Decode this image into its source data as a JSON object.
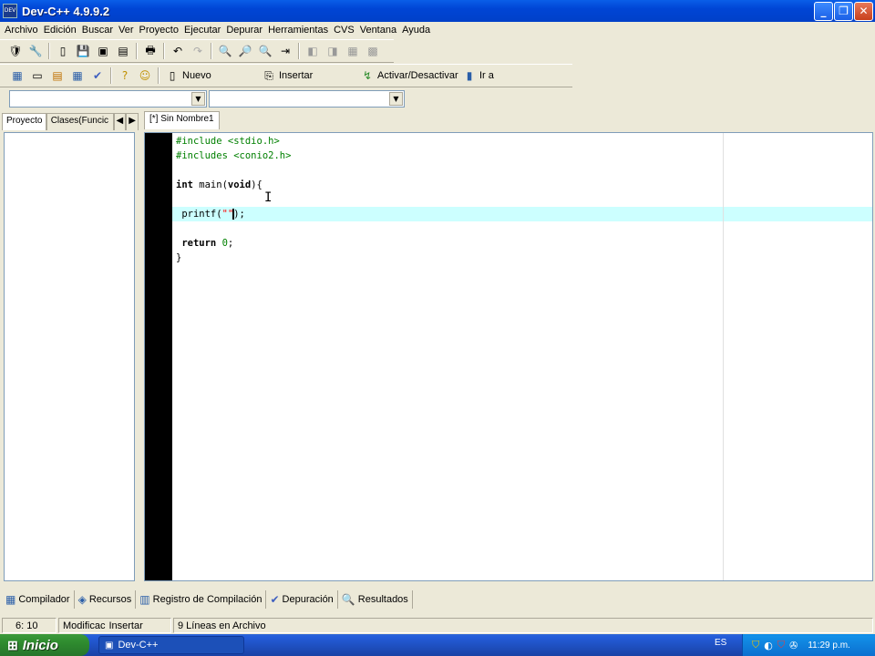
{
  "window": {
    "title": "Dev-C++ 4.9.9.2",
    "icon_label": "DEV"
  },
  "menu": [
    "Archivo",
    "Edición",
    "Buscar",
    "Ver",
    "Proyecto",
    "Ejecutar",
    "Depurar",
    "Herramientas",
    "CVS",
    "Ventana",
    "Ayuda"
  ],
  "toolbar2": {
    "nuevo": "Nuevo",
    "insertar": "Insertar",
    "activar": "Activar/Desactivar",
    "ir_a": "Ir a"
  },
  "left_tabs": {
    "proyecto": "Proyecto",
    "clases": "Clases(Funcic"
  },
  "editor_tab": "[*] Sin Nombre1",
  "code": {
    "l1": "#include <stdio.h>",
    "l2": "#includes <conio2.h>",
    "l4_kw": "int",
    "l4_mid": " main(",
    "l4_kw2": "void",
    "l4_end": "){",
    "l6_pre": " printf(",
    "l6_str": "\"\"",
    "l6_end": ");",
    "l8_kw": "return",
    "l8_num": "0",
    "l8_end": ";",
    "l9": "}"
  },
  "bottom_tabs": [
    "Compilador",
    "Recursos",
    "Registro de Compilación",
    "Depuración",
    "Resultados"
  ],
  "status": {
    "pos": "6: 10",
    "modified": "Modificac",
    "mode": "Insertar",
    "lines": "9 Líneas en Archivo"
  },
  "taskbar": {
    "start": "Inicio",
    "task": "Dev-C++",
    "lang": "ES",
    "clock": "11:29 p.m."
  },
  "icons": [
    "app-icon",
    "minimize-icon",
    "maximize-icon",
    "close-icon",
    "windows-flag-icon"
  ]
}
